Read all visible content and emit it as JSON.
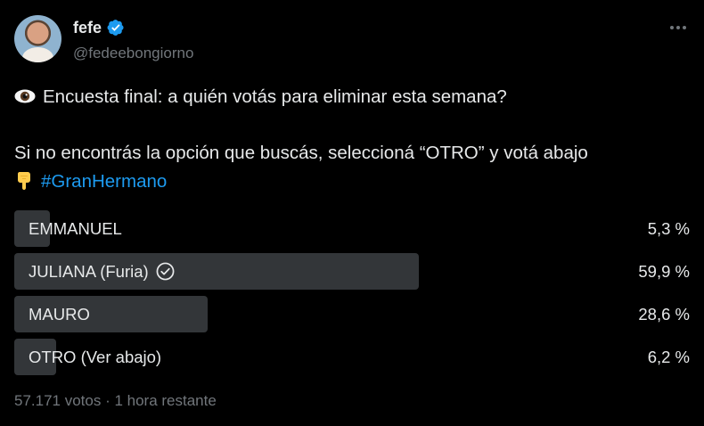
{
  "author": {
    "name": "fefe",
    "handle": "@fedeebongiorno",
    "verified": true,
    "avatar_icon": "avatar-photo"
  },
  "tweet": {
    "line1_icon": "eye-emoji",
    "line1": "Encuesta final: a quién votás para eliminar esta semana?",
    "line2": "Si no encontrás la opción que buscás, seleccioná “OTRO” y votá abajo",
    "line3_icon": "pointing-down-emoji",
    "hashtag": "#GranHermano"
  },
  "poll": {
    "options": [
      {
        "label": "EMMANUEL",
        "percent_text": "5,3 %",
        "percent": 5.3,
        "chosen": false
      },
      {
        "label": "JULIANA (Furia)",
        "percent_text": "59,9 %",
        "percent": 59.9,
        "chosen": true
      },
      {
        "label": "MAURO",
        "percent_text": "28,6 %",
        "percent": 28.6,
        "chosen": false
      },
      {
        "label": "OTRO (Ver abajo)",
        "percent_text": "6,2 %",
        "percent": 6.2,
        "chosen": false
      }
    ],
    "footer": "57.171 votos · 1 hora restante"
  },
  "colors": {
    "background": "#000000",
    "text": "#e7e9ea",
    "muted": "#71767b",
    "accent": "#1d9bf0",
    "bar": "#333639"
  }
}
